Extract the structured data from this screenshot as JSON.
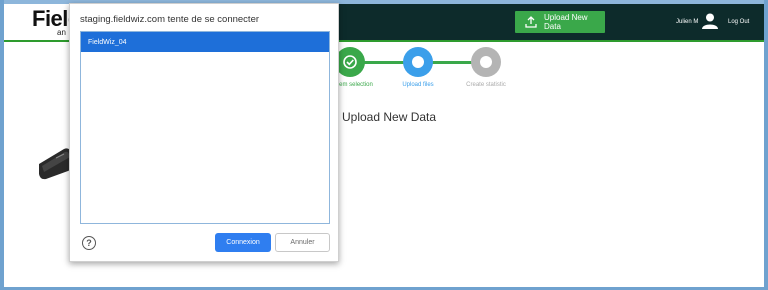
{
  "app": {
    "logo_text": "Field",
    "logo_subtext": "an",
    "upload_button_label": "Upload New Data",
    "user_name": "Julien M",
    "logout_label": "Log Out",
    "page_heading": "Upload New Data"
  },
  "stepper": {
    "steps": [
      {
        "label": "em selection",
        "state": "done",
        "color": "#3aa84a"
      },
      {
        "label": "Upload files",
        "state": "current",
        "color": "#3b9fea"
      },
      {
        "label": "Create statistic",
        "state": "pending",
        "color": "#b4b4b4"
      }
    ]
  },
  "dialog": {
    "title": "staging.fieldwiz.com tente de se connecter",
    "devices": [
      "FieldWiz_04"
    ],
    "connect_label": "Connexion",
    "cancel_label": "Annuler",
    "help_glyph": "?"
  },
  "colors": {
    "header_dark": "#0d2b2b",
    "accent_green": "#3aa84a",
    "selection_blue": "#1e6fd9",
    "primary_button": "#2f7ef0"
  }
}
